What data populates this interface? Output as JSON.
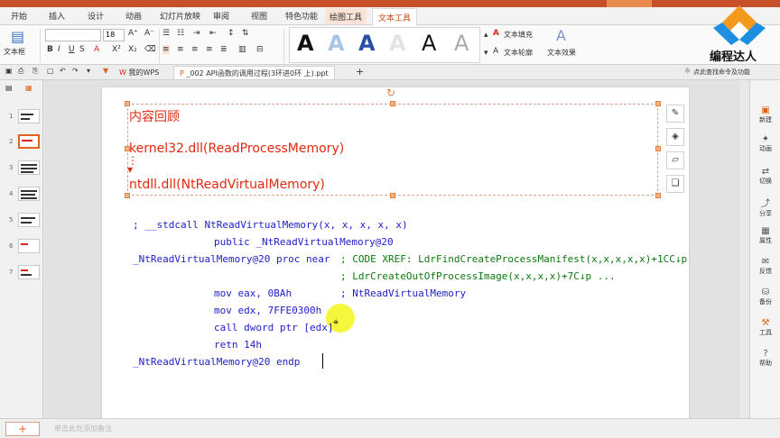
{
  "colors": {
    "accent": "#e0631c",
    "title_bar": "#c7502a",
    "slide_text_red": "#e02a10",
    "code_blue": "#1e1ec8",
    "code_green": "#0d7a0d"
  },
  "menu": {
    "tabs": [
      "开始",
      "插入",
      "设计",
      "动画",
      "幻灯片放映",
      "审阅",
      "视图",
      "特色功能",
      "绘图工具",
      "文本工具"
    ]
  },
  "ribbon": {
    "textbox_label": "文本框",
    "font_size": "18",
    "text_fill": "文本填充",
    "text_outline": "文本轮廓",
    "text_effect": "文本效果",
    "style_letter": "A"
  },
  "docbar": {
    "tab_wps": "我的WPS",
    "tab_doc": "_002 API函数的调用过程(3环进0环 上).ppt",
    "help": "点此查找命令及功能"
  },
  "thumbnails": [
    "1",
    "2",
    "3",
    "4",
    "5",
    "6",
    "7"
  ],
  "slide": {
    "title": "内容回顾",
    "line1": "kernel32.dll(ReadProcessMemory)",
    "line2": "ntdll.dll(NtReadVirtualMemory)",
    "code": [
      {
        "text": "; __stdcall NtReadVirtualMemory(x, x, x, x, x)",
        "color": "blue"
      },
      {
        "text": "public _NtReadVirtualMemory@20",
        "color": "blue"
      },
      {
        "text": "_NtReadVirtualMemory@20 proc near",
        "color": "blue"
      },
      {
        "text": "; CODE XREF: LdrFindCreateProcessManifest(x,x,x,x,x)+1CC↓p",
        "color": "green"
      },
      {
        "text": "; LdrCreateOutOfProcessImage(x,x,x,x)+7C↓p ...",
        "color": "green"
      },
      {
        "text": "mov     eax, 0BAh",
        "color": "blue"
      },
      {
        "text": "; NtReadVirtualMemory",
        "color": "blue"
      },
      {
        "text": "mov     edx, 7FFE0300h",
        "color": "blue"
      },
      {
        "text": "call    dword ptr [edx]",
        "color": "blue"
      },
      {
        "text": "retn    14h",
        "color": "blue"
      },
      {
        "text": "_NtReadVirtualMemory@20 endp",
        "color": "blue"
      }
    ]
  },
  "right_panel": [
    "新建",
    "动画",
    "切换",
    "分享",
    "属性",
    "反馈",
    "备份",
    "工具",
    "帮助"
  ],
  "status": {
    "add": "+",
    "notes_placeholder": "单击此处添加备注"
  },
  "logo": {
    "text": "编程达人"
  }
}
